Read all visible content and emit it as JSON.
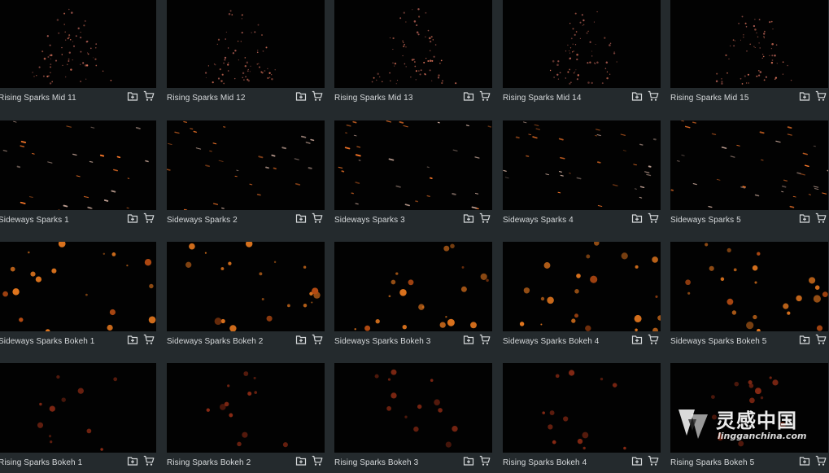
{
  "icons": {
    "add": "folder-plus-icon",
    "cart": "cart-icon"
  },
  "colors": {
    "background": "#242a2d",
    "thumb": "#020202",
    "spark": "#ff7a2a",
    "label": "#d6d9db"
  },
  "rows": [
    {
      "style": "rising",
      "items": [
        {
          "label": "Rising Sparks Mid 11"
        },
        {
          "label": "Rising Sparks Mid 12"
        },
        {
          "label": "Rising Sparks Mid 13"
        },
        {
          "label": "Rising Sparks Mid 14"
        },
        {
          "label": "Rising Sparks Mid 15"
        }
      ]
    },
    {
      "style": "sideways",
      "items": [
        {
          "label": "Sideways Sparks 1"
        },
        {
          "label": "Sideways Sparks 2"
        },
        {
          "label": "Sideways Sparks 3"
        },
        {
          "label": "Sideways Sparks 4"
        },
        {
          "label": "Sideways Sparks 5"
        }
      ]
    },
    {
      "style": "bokeh",
      "items": [
        {
          "label": "Sideways Sparks Bokeh 1"
        },
        {
          "label": "Sideways Sparks Bokeh 2"
        },
        {
          "label": "Sideways Sparks Bokeh 3"
        },
        {
          "label": "Sideways Sparks Bokeh 4"
        },
        {
          "label": "Sideways Sparks Bokeh 5"
        }
      ]
    },
    {
      "style": "rising-bokeh",
      "items": [
        {
          "label": "Rising Sparks Bokeh 1"
        },
        {
          "label": "Rising Sparks Bokeh 2"
        },
        {
          "label": "Rising Sparks Bokeh 3"
        },
        {
          "label": "Rising Sparks Bokeh 4"
        },
        {
          "label": "Rising Sparks Bokeh 5"
        }
      ]
    }
  ],
  "watermark": {
    "text": "灵感中国",
    "url": "lingganchina.com"
  }
}
